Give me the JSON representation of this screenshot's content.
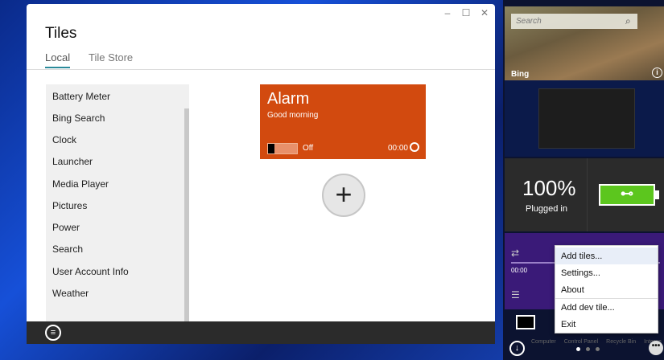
{
  "window": {
    "title": "Tiles",
    "tabs": [
      {
        "label": "Local"
      },
      {
        "label": "Tile Store"
      }
    ],
    "controls": {
      "minimize": "–",
      "maximize": "☐",
      "close": "✕"
    }
  },
  "tile_list": [
    "Battery Meter",
    "Bing Search",
    "Clock",
    "Launcher",
    "Media Player",
    "Pictures",
    "Power",
    "Search",
    "User Account Info",
    "Weather"
  ],
  "alarm_tile": {
    "title": "Alarm",
    "subtitle": "Good morning",
    "toggle_state": "Off",
    "time": "00:00"
  },
  "add_button": "+",
  "sidebar": {
    "bing": {
      "search_placeholder": "Search",
      "label": "Bing"
    },
    "battery": {
      "percent": "100%",
      "status": "Plugged in"
    },
    "media": {
      "time": "00:00"
    },
    "taskbar_labels": [
      "Computer",
      "Control Panel",
      "Recycle Bin",
      "Interne"
    ]
  },
  "context_menu": [
    "Add tiles...",
    "Settings...",
    "About",
    "Add dev tile...",
    "Exit"
  ],
  "colors": {
    "accent": "#d24a0f",
    "tab_underline": "#2a8a9a",
    "battery": "#5cc61e"
  }
}
